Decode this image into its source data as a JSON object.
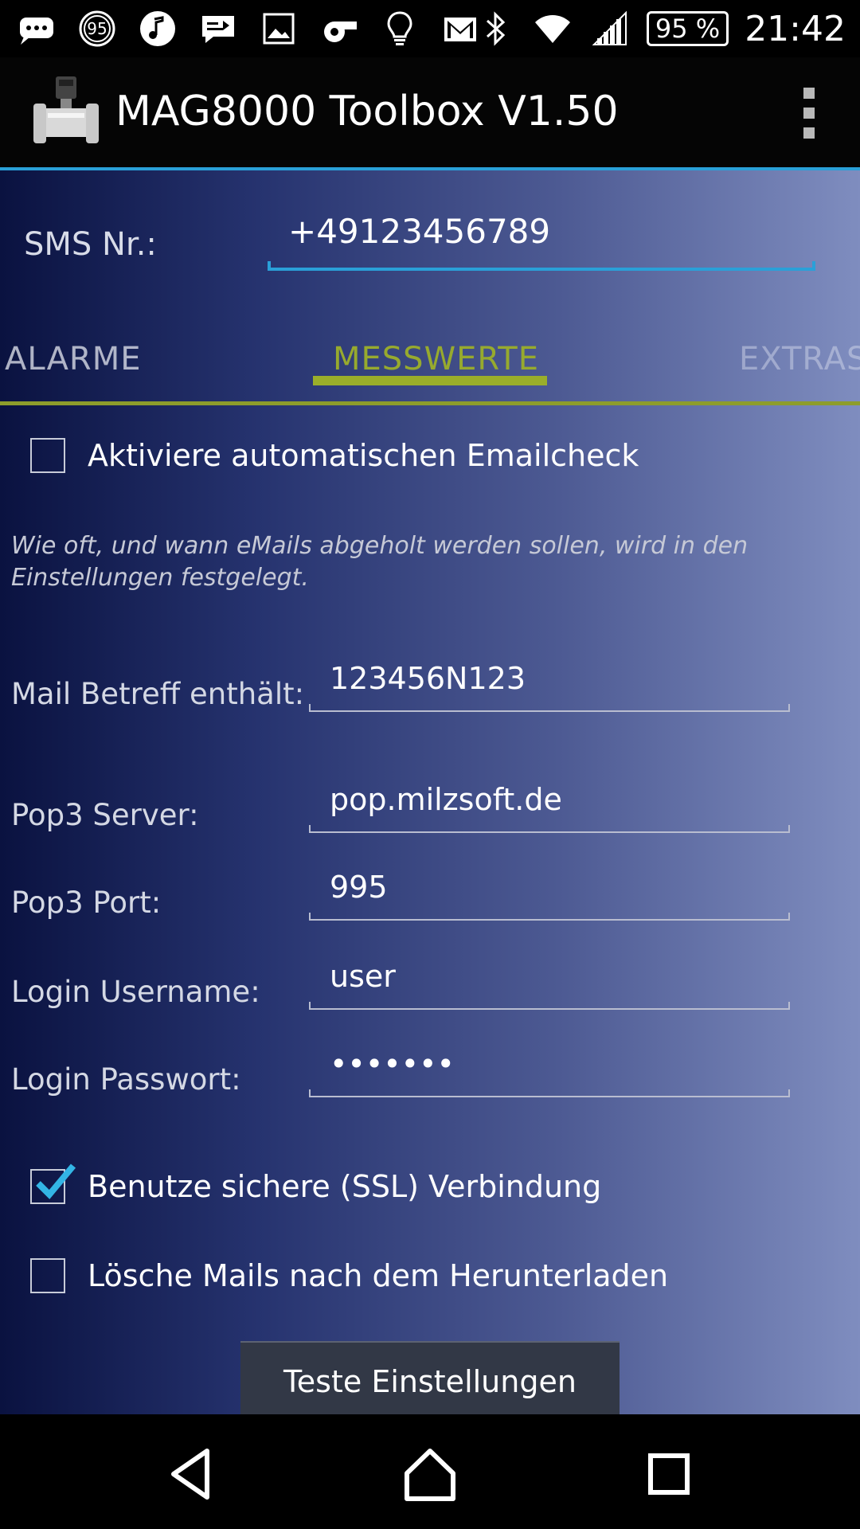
{
  "status_bar": {
    "left_icons": [
      "chat-bubble-icon",
      "badge-95-icon",
      "music-note-icon",
      "message-icon",
      "image-icon",
      "whistle-icon",
      "lightbulb-icon",
      "gmail-icon"
    ],
    "badge_text": "95",
    "right_icons": [
      "bluetooth-icon",
      "wifi-icon",
      "cellular-signal-icon"
    ],
    "battery": "95 %",
    "time": "21:42"
  },
  "action_bar": {
    "title": "MAG8000 Toolbox V1.50",
    "logo": "flowmeter-logo",
    "overflow_icon": "overflow-menu-icon"
  },
  "sms": {
    "label": "SMS Nr.:",
    "value": "+49123456789"
  },
  "tabs": [
    {
      "label": "ALARME",
      "selected": false
    },
    {
      "label": "MESSWERTE",
      "selected": true
    },
    {
      "label": "EXTRAS",
      "selected": false
    }
  ],
  "email_check": {
    "label": "Aktiviere automatischen Emailcheck",
    "checked": false
  },
  "hint": "Wie oft, und wann eMails abgeholt werden sollen, wird in den Einstellungen festgelegt.",
  "fields": {
    "subject": {
      "label": "Mail Betreff enthält:",
      "value": "123456N123"
    },
    "pop3_server": {
      "label": "Pop3 Server:",
      "value": "pop.milzsoft.de"
    },
    "pop3_port": {
      "label": "Pop3 Port:",
      "value": "995"
    },
    "username": {
      "label": "Login Username:",
      "value": "user"
    },
    "password": {
      "label": "Login Passwort:",
      "value": "•••••••"
    }
  },
  "ssl": {
    "label": "Benutze sichere (SSL) Verbindung",
    "checked": true
  },
  "delete_mails": {
    "label": "Lösche Mails nach dem Herunterladen",
    "checked": false
  },
  "test_button": "Teste Einstellungen",
  "colors": {
    "accent_blue": "#2aa0d8",
    "tab_green": "#9aae2a",
    "check_blue": "#33b5e5"
  },
  "nav_bar": [
    "back-icon",
    "home-icon",
    "recents-icon"
  ]
}
